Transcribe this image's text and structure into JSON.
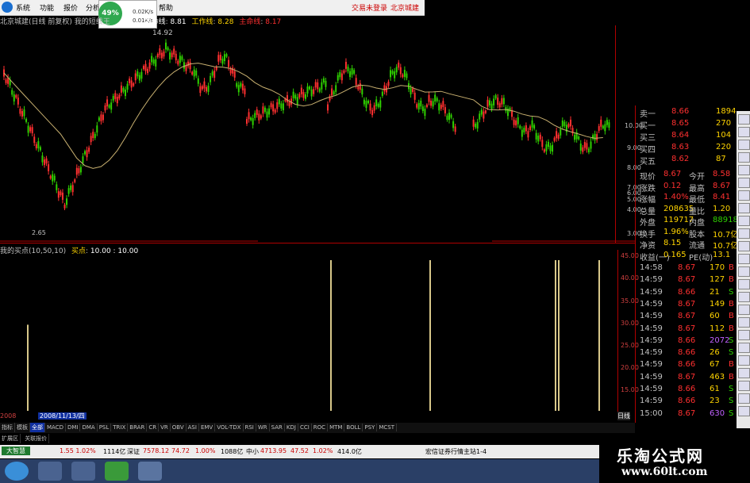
{
  "menu": {
    "items": [
      "系统",
      "功能",
      "报价",
      "分析"
    ],
    "help": "帮助",
    "login": "交易未登录",
    "stock_link": "北京城建"
  },
  "speed": {
    "percent": "49%",
    "up": "0.02K/s",
    "down": "0.01K/s"
  },
  "header": {
    "title": "北京城建(日线 前复权) 我的短线王",
    "line1_label": "生命线",
    "line1_value": "8.81",
    "line2_label": "工作线",
    "line2_value": "8.28",
    "line3_label": "主命线",
    "line3_value": "8.17",
    "peak": "14.92",
    "low": "2.65"
  },
  "indicator": {
    "title": "我的买点(10,50,10)",
    "label": "买点",
    "value": "10.00 : 10.00"
  },
  "y_axis_upper": [
    "10.00",
    "9.00",
    "8.00",
    "7.00",
    "6.00",
    "5.00",
    "4.00",
    "3.00"
  ],
  "y_axis_lower": [
    "45.00",
    "40.00",
    "35.00",
    "30.00",
    "25.00",
    "20.00",
    "15.00"
  ],
  "order_book": [
    {
      "label": "卖一",
      "price": "8.66",
      "vol": "1894"
    },
    {
      "label": "买一",
      "price": "8.65",
      "vol": "270"
    },
    {
      "label": "买三",
      "price": "8.64",
      "vol": "104"
    },
    {
      "label": "买四",
      "price": "8.63",
      "vol": "220"
    },
    {
      "label": "买五",
      "price": "8.62",
      "vol": "87"
    }
  ],
  "stats": [
    {
      "l1": "现价",
      "v1": "8.67",
      "l2": "今开",
      "v2": "8.58"
    },
    {
      "l1": "涨跌",
      "v1": "0.12",
      "l2": "最高",
      "v2": "8.67"
    },
    {
      "l1": "涨幅",
      "v1": "1.40%",
      "l2": "最低",
      "v2": "8.41"
    },
    {
      "l1": "总量",
      "v1": "208635",
      "l2": "量比",
      "v2": "1.20"
    },
    {
      "l1": "外盘",
      "v1": "119717",
      "l2": "内盘",
      "v2": "88918"
    },
    {
      "l1": "换手",
      "v1": "1.96%",
      "l2": "股本",
      "v2": "10.7亿"
    },
    {
      "l1": "净资",
      "v1": "8.15",
      "l2": "流通",
      "v2": "10.7亿"
    },
    {
      "l1": "收益(一)",
      "v1": "0.165",
      "l2": "PE(动)",
      "v2": "13.1"
    }
  ],
  "ticks": [
    {
      "time": "14:58",
      "price": "8.67",
      "vol": "170",
      "side": "B"
    },
    {
      "time": "14:59",
      "price": "8.67",
      "vol": "127",
      "side": "B"
    },
    {
      "time": "14:59",
      "price": "8.66",
      "vol": "21",
      "side": "S"
    },
    {
      "time": "14:59",
      "price": "8.67",
      "vol": "149",
      "side": "B"
    },
    {
      "time": "14:59",
      "price": "8.67",
      "vol": "60",
      "side": "B"
    },
    {
      "time": "14:59",
      "price": "8.67",
      "vol": "112",
      "side": "B"
    },
    {
      "time": "14:59",
      "price": "8.66",
      "vol": "2072",
      "side": "S"
    },
    {
      "time": "14:59",
      "price": "8.66",
      "vol": "26",
      "side": "S"
    },
    {
      "time": "14:59",
      "price": "8.66",
      "vol": "67",
      "side": "B"
    },
    {
      "time": "14:59",
      "price": "8.67",
      "vol": "463",
      "side": "B"
    },
    {
      "time": "14:59",
      "price": "8.66",
      "vol": "61",
      "side": "S"
    },
    {
      "time": "14:59",
      "price": "8.66",
      "vol": "23",
      "side": "S"
    },
    {
      "time": "15:00",
      "price": "8.67",
      "vol": "630",
      "side": "S"
    }
  ],
  "dates": {
    "year": "2008",
    "selected": "2008/11/13/四",
    "period": "日线"
  },
  "indicator_tabs": [
    "指标",
    "模板",
    "全部",
    "MACD",
    "DMI",
    "DMA",
    "PSL",
    "TRIX",
    "BRAR",
    "CR",
    "VR",
    "OBV",
    "ASI",
    "EMV",
    "VOL-TDX",
    "RSI",
    "WR",
    "SAR",
    "KDJ",
    "CCI",
    "ROC",
    "MTM",
    "BOLL",
    "PSY",
    "MCST"
  ],
  "tabs2": [
    "扩展区",
    "关联报价"
  ],
  "status": {
    "sh": "1.55 1.02%",
    "sh_amt": "1114亿",
    "sz_label": "深证",
    "sz": "7578.12",
    "sz_chg": "74.72",
    "sz_pct": "1.00%",
    "sz_amt": "1088亿",
    "zx_label": "中小",
    "zx": "4713.95",
    "zx_chg": "47.52",
    "zx_pct": "1.02%",
    "zx_amt": "414.0亿",
    "broker": "宏信证券行情主站1-4",
    "start": "大智慧"
  },
  "watermark": {
    "line1": "乐淘公式网",
    "line2": "www.60lt.com"
  },
  "colors": {
    "up": "#ff3030",
    "down": "#2fd000",
    "axis_red": "#b00000",
    "ma": "#c8b070"
  }
}
